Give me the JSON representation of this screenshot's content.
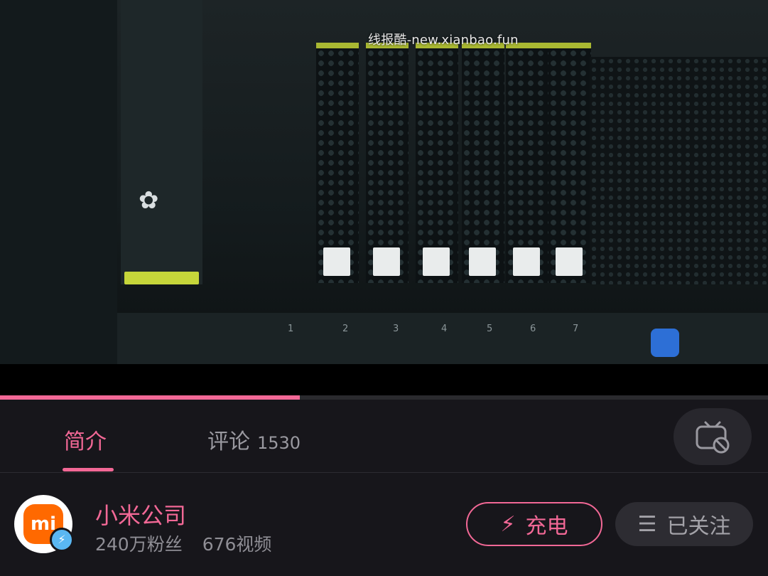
{
  "video": {
    "watermark": "线报酷-new.xianbao.fun",
    "slot_numbers": [
      "1",
      "2",
      "3",
      "4",
      "5",
      "6",
      "7"
    ],
    "progress_fraction": 0.39
  },
  "tabs": {
    "intro_label": "简介",
    "comments_label": "评论",
    "comments_count": "1530"
  },
  "author": {
    "name": "小米公司",
    "followers": "240万粉丝",
    "videos": "676视频",
    "avatar_text": "mi"
  },
  "actions": {
    "charge_label": "充电",
    "follow_label": "已关注"
  },
  "colors": {
    "accent": "#f26896",
    "background": "#17161b",
    "xiaomi_orange": "#ff6900"
  },
  "icons": {
    "charge": "lightning-icon",
    "follow": "menu-icon",
    "tv": "tv-no-danmaku-icon",
    "verified": "verified-badge-icon"
  }
}
